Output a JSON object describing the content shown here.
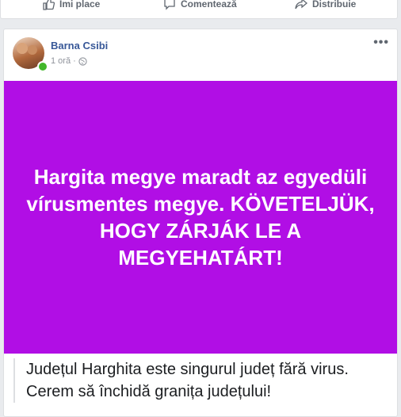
{
  "prev_post": {
    "actions": [
      {
        "label": "Îmi place",
        "icon": "like-icon"
      },
      {
        "label": "Comentează",
        "icon": "comment-icon"
      },
      {
        "label": "Distribuie",
        "icon": "share-icon"
      }
    ]
  },
  "post": {
    "author": "Barna Csibi",
    "time": "1 oră",
    "separator": "·",
    "privacy_icon": "globe-icon",
    "more_icon": "more-options-icon",
    "more_text": "•••",
    "banner_bg": "#b10ee5",
    "banner_text": "Hargita megye maradt az egyedüli vírusmentes megye. KÖVETELJÜK, HOGY ZÁRJÁK LE A MEGYEHATÁRT!",
    "translation": "Județul Harghita este singurul județ fără virus. Cerem să închidă granița județului!"
  },
  "colors": {
    "link": "#385898",
    "online": "#42b72a"
  }
}
